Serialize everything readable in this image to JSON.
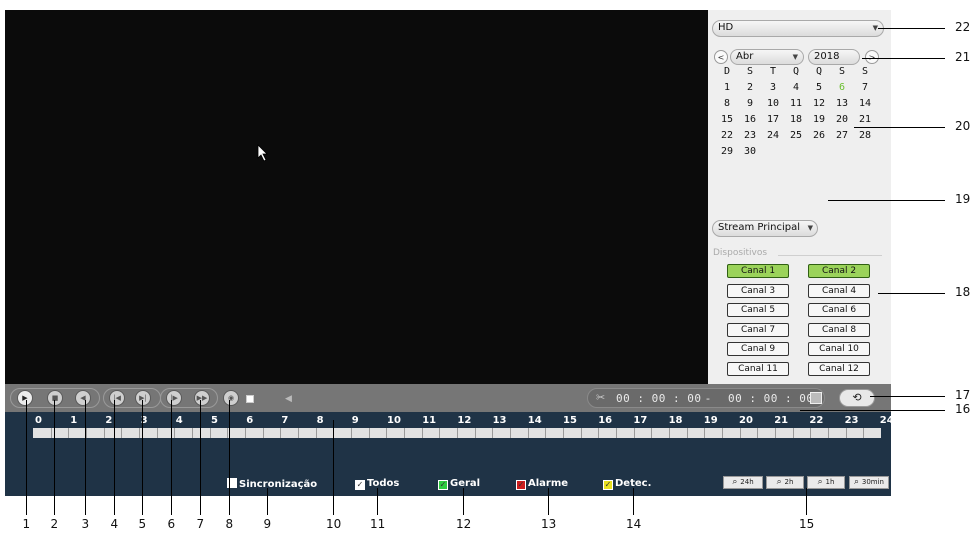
{
  "right_panel": {
    "quality_select": "HD",
    "month_select": "Abr",
    "year_select": "2018",
    "prev_label": "<",
    "next_label": ">",
    "weekdays": [
      "D",
      "S",
      "T",
      "Q",
      "Q",
      "S",
      "S"
    ],
    "days": [
      "1",
      "2",
      "3",
      "4",
      "5",
      "6",
      "7",
      "8",
      "9",
      "10",
      "11",
      "12",
      "13",
      "14",
      "15",
      "16",
      "17",
      "18",
      "19",
      "20",
      "21",
      "22",
      "23",
      "24",
      "25",
      "26",
      "27",
      "28",
      "29",
      "30"
    ],
    "highlight_day": "6",
    "stream_select": "Stream Principal",
    "devices_label": "Dispositivos",
    "channels": [
      "Canal 1",
      "Canal 2",
      "Canal 3",
      "Canal 4",
      "Canal 5",
      "Canal 6",
      "Canal 7",
      "Canal 8",
      "Canal 9",
      "Canal 10",
      "Canal 11",
      "Canal 12"
    ],
    "active_channels": [
      "Canal 1",
      "Canal 2"
    ]
  },
  "control_bar": {
    "buttons": [
      "play-icon",
      "stop-icon",
      "reverse-play-icon",
      "previous-frame-icon",
      "next-frame-icon",
      "slow-play-icon",
      "fast-play-icon",
      "smart-search-icon"
    ],
    "time_start": "00 : 00 : 00",
    "time_separator": "-",
    "time_end": "00 : 00 : 00",
    "refresh_icon": "refresh-icon"
  },
  "timeline": {
    "hours": [
      "0",
      "1",
      "2",
      "3",
      "4",
      "5",
      "6",
      "7",
      "8",
      "9",
      "10",
      "11",
      "12",
      "13",
      "14",
      "15",
      "16",
      "17",
      "18",
      "19",
      "20",
      "21",
      "22",
      "23",
      "24"
    ]
  },
  "filters": {
    "sync": "Sincronização",
    "all": "Todos",
    "general": "Geral",
    "alarm": "Alarme",
    "detect": "Detec."
  },
  "zoom_buttons": [
    "24h",
    "2h",
    "1h",
    "30min"
  ],
  "callouts": {
    "bottom": [
      "1",
      "2",
      "3",
      "4",
      "5",
      "6",
      "7",
      "8",
      "9",
      "10",
      "11",
      "12",
      "13",
      "14",
      "15"
    ],
    "right": [
      "22",
      "21",
      "20",
      "19",
      "18",
      "17",
      "16"
    ]
  },
  "colors": {
    "active_channel": "#9bd35a",
    "timeline_bg": "#1f3346",
    "geral": "#2ecc40",
    "alarme": "#cc1e1e",
    "detec": "#e8e020"
  }
}
